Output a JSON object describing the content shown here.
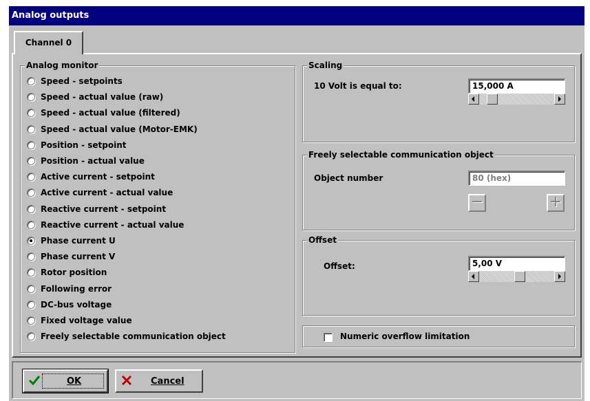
{
  "window": {
    "title": "Analog outputs"
  },
  "tabs": [
    {
      "label": "Channel 0"
    }
  ],
  "analog_monitor": {
    "title": "Analog monitor",
    "selected_index": 10,
    "options": [
      "Speed - setpoints",
      "Speed - actual value (raw)",
      "Speed - actual value (filtered)",
      "Speed - actual value (Motor-EMK)",
      "Position - setpoint",
      "Position - actual value",
      "Active current - setpoint",
      "Active current - actual value",
      "Reactive current - setpoint",
      "Reactive current - actual value",
      "Phase current  U",
      "Phase current  V",
      "Rotor position",
      "Following error",
      "DC-bus voltage",
      "Fixed voltage value",
      "Freely selectable communication object"
    ]
  },
  "scaling": {
    "title": "Scaling",
    "label": "10 Volt is equal to:",
    "value": "15,000 A",
    "slider_fraction": 0.12
  },
  "comm_object": {
    "title": "Freely selectable communication object",
    "label": "Object number",
    "value": "80 (hex)",
    "minus": "−",
    "plus": "+"
  },
  "offset": {
    "title": "Offset",
    "label": "Offset:",
    "value": "5,00 V",
    "slider_fraction": 0.55
  },
  "overflow": {
    "label": "Numeric overflow limitation",
    "checked": false
  },
  "buttons": {
    "ok": "OK",
    "cancel": "Cancel"
  },
  "colors": {
    "titlebar": "#000080",
    "face": "#c0c0c0",
    "ok_check": "#008000",
    "cancel_x": "#c00000"
  }
}
